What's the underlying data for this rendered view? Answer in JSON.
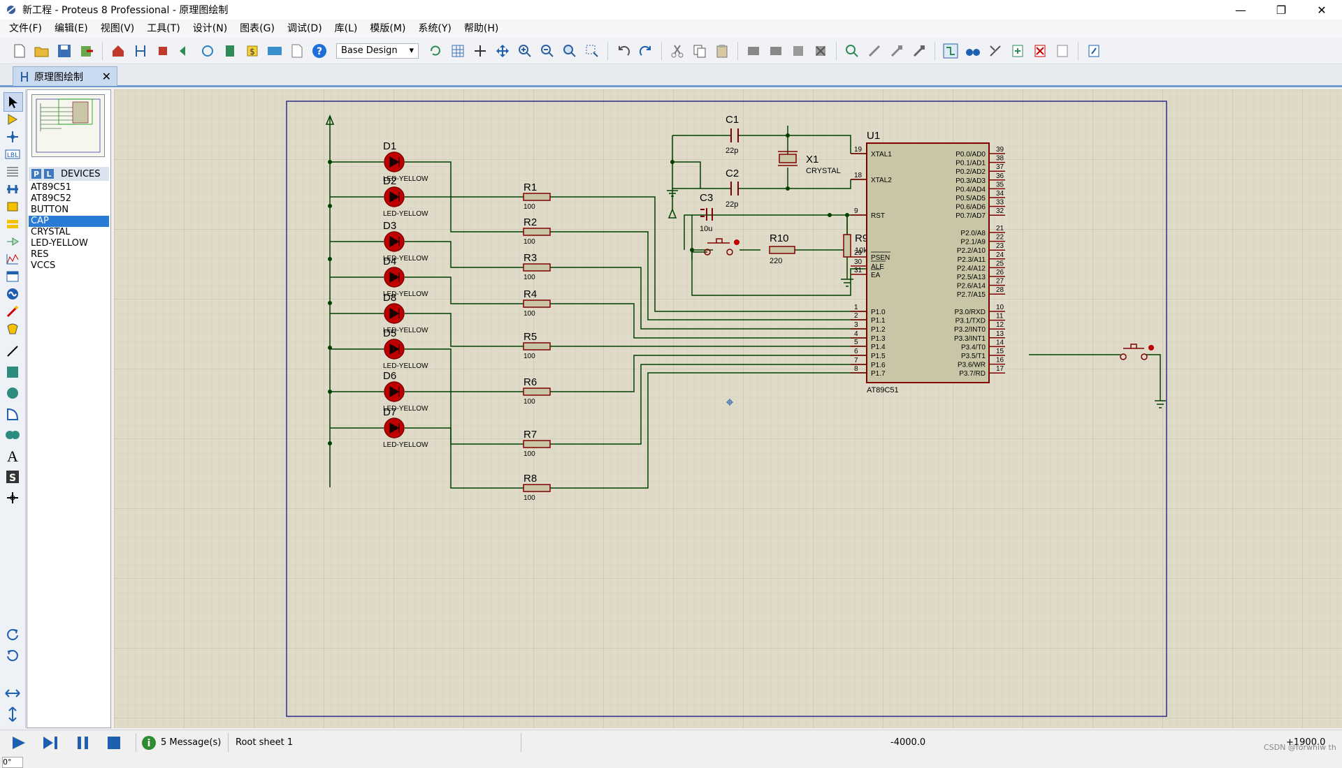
{
  "window": {
    "title": "新工程 - Proteus 8 Professional - 原理图绘制",
    "minimize": "—",
    "restore": "❐",
    "close": "✕"
  },
  "menu": [
    "文件(F)",
    "编辑(E)",
    "视图(V)",
    "工具(T)",
    "设计(N)",
    "图表(G)",
    "调试(D)",
    "库(L)",
    "模版(M)",
    "系统(Y)",
    "帮助(H)"
  ],
  "toolbar": {
    "design_combo": "Base Design"
  },
  "tab": {
    "label": "原理图绘制",
    "close": "✕"
  },
  "panel": {
    "p": "P",
    "l": "L",
    "header": "DEVICES",
    "devices": [
      "AT89C51",
      "AT89C52",
      "BUTTON",
      "CAP",
      "CRYSTAL",
      "LED-YELLOW",
      "RES",
      "VCCS"
    ],
    "selected_index": 3
  },
  "rotation": "0°",
  "schematic": {
    "leds": [
      {
        "ref": "D1",
        "value": "LED-YELLOW"
      },
      {
        "ref": "D2",
        "value": "LED-YELLOW"
      },
      {
        "ref": "D3",
        "value": "LED-YELLOW"
      },
      {
        "ref": "D4",
        "value": "LED-YELLOW"
      },
      {
        "ref": "D8",
        "value": "LED-YELLOW"
      },
      {
        "ref": "D5",
        "value": "LED-YELLOW"
      },
      {
        "ref": "D6",
        "value": "LED-YELLOW"
      },
      {
        "ref": "D7",
        "value": "LED-YELLOW"
      }
    ],
    "resistors": [
      {
        "ref": "R1",
        "value": "100"
      },
      {
        "ref": "R2",
        "value": "100"
      },
      {
        "ref": "R3",
        "value": "100"
      },
      {
        "ref": "R4",
        "value": "100"
      },
      {
        "ref": "R5",
        "value": "100"
      },
      {
        "ref": "R6",
        "value": "100"
      },
      {
        "ref": "R7",
        "value": "100"
      },
      {
        "ref": "R8",
        "value": "100"
      }
    ],
    "c1": {
      "ref": "C1",
      "value": "22p"
    },
    "c2": {
      "ref": "C2",
      "value": "22p"
    },
    "c3": {
      "ref": "C3",
      "value": "10u"
    },
    "x1": {
      "ref": "X1",
      "value": "CRYSTAL"
    },
    "r9": {
      "ref": "R9",
      "value": "10k"
    },
    "r10": {
      "ref": "R10",
      "value": "220"
    },
    "u1": {
      "ref": "U1",
      "part": "AT89C51",
      "left_pins": [
        {
          "num": "19",
          "name": "XTAL1"
        },
        {
          "num": "18",
          "name": "XTAL2"
        },
        {
          "num": "9",
          "name": "RST"
        },
        {
          "num": "29",
          "name": "PSEN"
        },
        {
          "num": "30",
          "name": "ALE"
        },
        {
          "num": "31",
          "name": "EA"
        },
        {
          "num": "1",
          "name": "P1.0"
        },
        {
          "num": "2",
          "name": "P1.1"
        },
        {
          "num": "3",
          "name": "P1.2"
        },
        {
          "num": "4",
          "name": "P1.3"
        },
        {
          "num": "5",
          "name": "P1.4"
        },
        {
          "num": "6",
          "name": "P1.5"
        },
        {
          "num": "7",
          "name": "P1.6"
        },
        {
          "num": "8",
          "name": "P1.7"
        }
      ],
      "right_pins": [
        {
          "num": "39",
          "name": "P0.0/AD0"
        },
        {
          "num": "38",
          "name": "P0.1/AD1"
        },
        {
          "num": "37",
          "name": "P0.2/AD2"
        },
        {
          "num": "36",
          "name": "P0.3/AD3"
        },
        {
          "num": "35",
          "name": "P0.4/AD4"
        },
        {
          "num": "34",
          "name": "P0.5/AD5"
        },
        {
          "num": "33",
          "name": "P0.6/AD6"
        },
        {
          "num": "32",
          "name": "P0.7/AD7"
        },
        {
          "num": "21",
          "name": "P2.0/A8"
        },
        {
          "num": "22",
          "name": "P2.1/A9"
        },
        {
          "num": "23",
          "name": "P2.2/A10"
        },
        {
          "num": "24",
          "name": "P2.3/A11"
        },
        {
          "num": "25",
          "name": "P2.4/A12"
        },
        {
          "num": "26",
          "name": "P2.5/A13"
        },
        {
          "num": "27",
          "name": "P2.6/A14"
        },
        {
          "num": "28",
          "name": "P2.7/A15"
        },
        {
          "num": "10",
          "name": "P3.0/RXD"
        },
        {
          "num": "11",
          "name": "P3.1/TXD"
        },
        {
          "num": "12",
          "name": "P3.2/INT0"
        },
        {
          "num": "13",
          "name": "P3.3/INT1"
        },
        {
          "num": "14",
          "name": "P3.4/T0"
        },
        {
          "num": "15",
          "name": "P3.5/T1"
        },
        {
          "num": "16",
          "name": "P3.6/WR"
        },
        {
          "num": "17",
          "name": "P3.7/RD"
        }
      ]
    }
  },
  "status": {
    "messages": "5 Message(s)",
    "sheet": "Root sheet 1",
    "coord_x": "-4000.0",
    "coord_y": "+1900.0",
    "watermark": "CSDN @forwhiw th"
  },
  "colors": {
    "wire": "#004000",
    "component": "#800000",
    "body": "#c8c6a6",
    "sheet_border": "#00007f",
    "grid_bg": "#dfdbc8",
    "pin": "#b40000"
  }
}
